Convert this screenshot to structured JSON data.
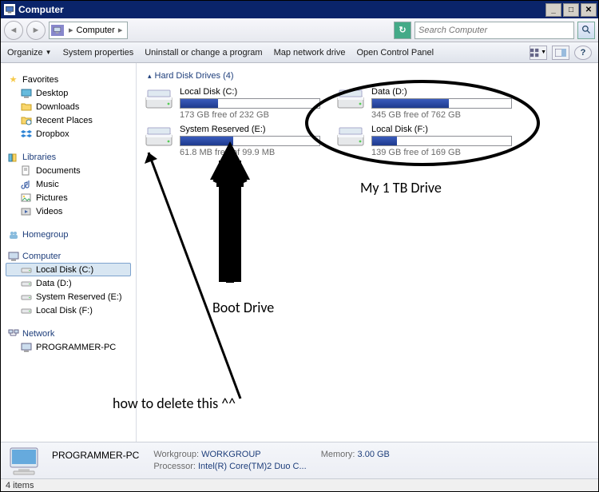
{
  "titlebar": {
    "title": "Computer"
  },
  "breadcrumb": {
    "label": "Computer"
  },
  "search": {
    "placeholder": "Search Computer"
  },
  "cmdbar": {
    "organize": "Organize",
    "sysprops": "System properties",
    "uninstall": "Uninstall or change a program",
    "mapnet": "Map network drive",
    "opencp": "Open Control Panel"
  },
  "sidebar": {
    "favorites": {
      "label": "Favorites",
      "items": [
        "Desktop",
        "Downloads",
        "Recent Places",
        "Dropbox"
      ]
    },
    "libraries": {
      "label": "Libraries",
      "items": [
        "Documents",
        "Music",
        "Pictures",
        "Videos"
      ]
    },
    "homegroup": {
      "label": "Homegroup"
    },
    "computer": {
      "label": "Computer",
      "items": [
        "Local Disk (C:)",
        "Data (D:)",
        "System Reserved (E:)",
        "Local Disk (F:)"
      ]
    },
    "network": {
      "label": "Network",
      "items": [
        "PROGRAMMER-PC"
      ]
    }
  },
  "content": {
    "group_header": "Hard Disk Drives (4)",
    "drives": [
      {
        "name": "Local Disk (C:)",
        "free": "173 GB free of 232 GB",
        "fill": 27
      },
      {
        "name": "Data (D:)",
        "free": "345 GB free of 762 GB",
        "fill": 55
      },
      {
        "name": "System Reserved (E:)",
        "free": "61.8 MB free of 99.9 MB",
        "fill": 38
      },
      {
        "name": "Local Disk (F:)",
        "free": "139 GB free of 169 GB",
        "fill": 18
      }
    ]
  },
  "annotations": {
    "my1tb": "My 1 TB Drive",
    "boot": "Boot Drive",
    "howdel": "how to delete this ^^"
  },
  "details": {
    "name": "PROGRAMMER-PC",
    "workgroup_lbl": "Workgroup:",
    "workgroup_val": "WORKGROUP",
    "memory_lbl": "Memory:",
    "memory_val": "3.00 GB",
    "proc_lbl": "Processor:",
    "proc_val": "Intel(R) Core(TM)2 Duo C..."
  },
  "status": {
    "text": "4 items"
  }
}
